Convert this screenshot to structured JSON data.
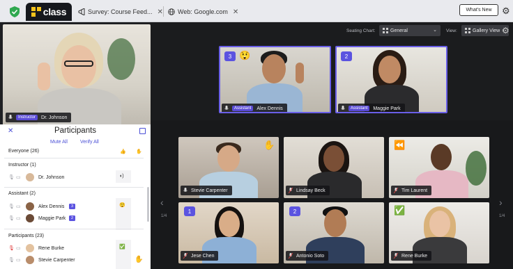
{
  "tabs": {
    "app_name": "class",
    "tab1": "Survey: Course Feed...",
    "tab2": "Web: Google.com",
    "close": "✕",
    "whats_new": "What's New"
  },
  "controls": {
    "seating_label": "Seating Chart:",
    "seating_value": "General",
    "view_label": "View:",
    "view_value": "Gallery View"
  },
  "instructor": {
    "role": "Instructor",
    "name": "Dr. Johnson"
  },
  "spotlight": [
    {
      "role": "Assistant",
      "name": "Alex Dennis",
      "badge": "3",
      "emoji": "😲"
    },
    {
      "role": "Assistant",
      "name": "Maggie Park",
      "badge": "2"
    }
  ],
  "gallery": [
    {
      "name": "Stevie Carpenter",
      "emoji": "✋"
    },
    {
      "name": "Lindsay Beck"
    },
    {
      "name": "Tim Laurent",
      "emoji": "⏪"
    },
    {
      "name": "Jese Chen",
      "badge": "1"
    },
    {
      "name": "Antonio Soto",
      "badge": "2"
    },
    {
      "name": "Rene Burke",
      "emoji": "✅"
    }
  ],
  "pager": {
    "left": "1/4",
    "right": "1/4"
  },
  "participants_panel": {
    "title": "Participants",
    "mute_all": "Mute All",
    "verify_all": "Verify All",
    "everyone": "Everyone (26)",
    "instructor_header": "Instructor (1)",
    "instructor_name": "Dr. Johnson",
    "assistant_header": "Assistant (2)",
    "assistants": [
      {
        "name": "Alex Dennis",
        "badge": "3"
      },
      {
        "name": "Maggie Park",
        "badge": "2"
      }
    ],
    "participants_header": "Participants (23)",
    "participants": [
      {
        "name": "Rene Burke"
      },
      {
        "name": "Stevie Carpenter"
      }
    ]
  },
  "colors": {
    "accent": "#5b53e0",
    "link": "#4a4fd6",
    "brand_yellow": "#f5c31c"
  }
}
